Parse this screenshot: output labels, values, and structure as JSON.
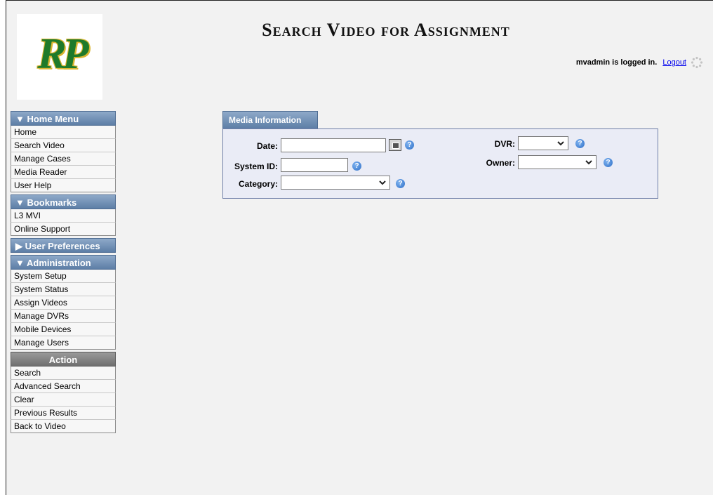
{
  "header": {
    "title": "Search Video for Assignment",
    "logo_text": "RP",
    "login_text": "mvadmin is logged in.",
    "logout_label": "Logout"
  },
  "sidebar": {
    "home_menu": {
      "title": "▼ Home Menu",
      "items": [
        "Home",
        "Search Video",
        "Manage Cases",
        "Media Reader",
        "User Help"
      ]
    },
    "bookmarks": {
      "title": "▼  Bookmarks",
      "items": [
        "L3 MVI",
        "Online Support"
      ]
    },
    "user_preferences": {
      "title": "▶  User Preferences"
    },
    "administration": {
      "title": "▼ Administration",
      "items": [
        "System Setup",
        "System Status",
        "Assign Videos",
        "Manage DVRs",
        "Mobile Devices",
        "Manage Users"
      ]
    },
    "action": {
      "title": "Action",
      "items": [
        "Search",
        "Advanced Search",
        "Clear",
        "Previous Results",
        "Back to Video"
      ]
    }
  },
  "form": {
    "tab_label": "Media Information",
    "date_label": "Date:",
    "date_value": "",
    "system_id_label": "System ID:",
    "system_id_value": "",
    "category_label": "Category:",
    "category_value": "",
    "dvr_label": "DVR:",
    "dvr_value": "",
    "owner_label": "Owner:",
    "owner_value": ""
  },
  "colors": {
    "menu_header": "#5d7ea6",
    "action_header": "#6f6f6f",
    "panel_bg": "#eaecf6",
    "logo_green": "#1e7a2a",
    "logo_gold": "#d9b531"
  },
  "icons": {
    "help": "help-icon",
    "calendar": "calendar-icon",
    "spinner": "spinner-icon",
    "dropdown": "chevron-down-icon"
  }
}
